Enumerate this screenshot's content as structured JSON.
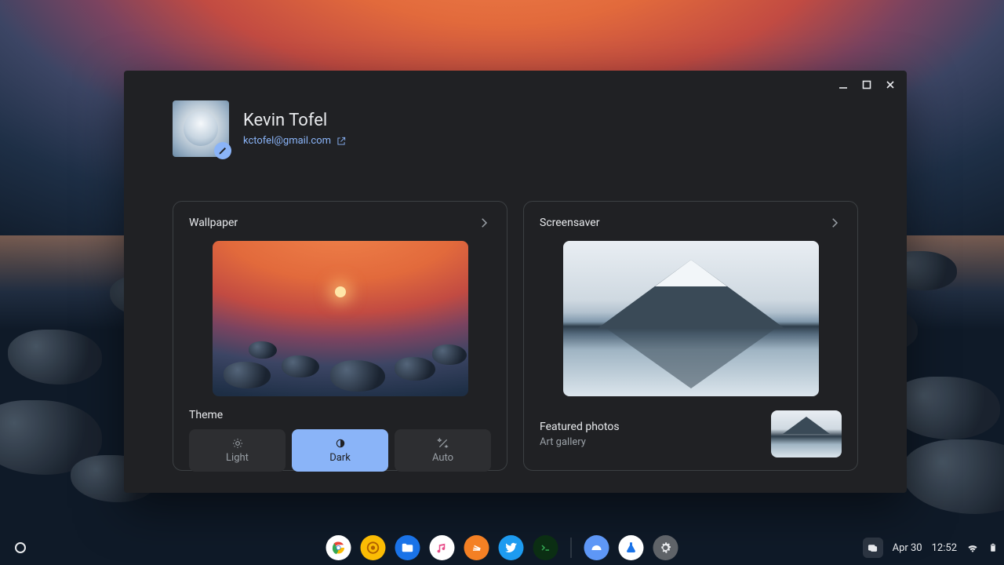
{
  "profile": {
    "name": "Kevin Tofel",
    "email": "kctofel@gmail.com"
  },
  "wallpaper_card": {
    "title": "Wallpaper",
    "theme_label": "Theme",
    "themes": {
      "light": "Light",
      "dark": "Dark",
      "auto": "Auto",
      "selected": "dark"
    }
  },
  "screensaver_card": {
    "title": "Screensaver",
    "featured_title": "Featured photos",
    "featured_sub": "Art gallery"
  },
  "shelf": {
    "apps": [
      "chrome",
      "canary",
      "files",
      "music",
      "stackoverflow",
      "twitter",
      "terminal",
      "jamboard",
      "lab",
      "settings"
    ],
    "status": {
      "date": "Apr 30",
      "time": "12:52"
    }
  },
  "colors": {
    "accent": "#8ab4f8",
    "bg": "#202124",
    "border": "#3c4043",
    "muted": "#9aa0a6"
  }
}
